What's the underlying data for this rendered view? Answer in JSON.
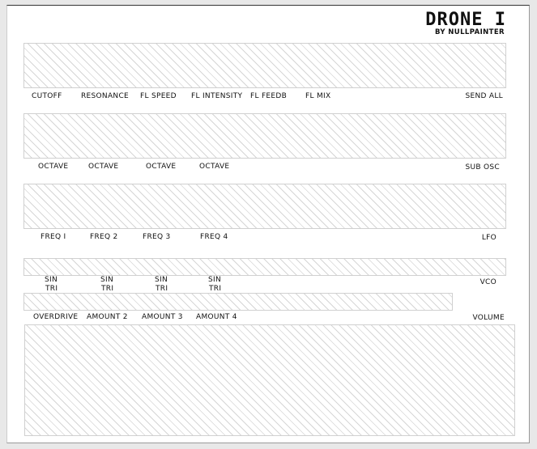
{
  "header": {
    "title": "DRONE I",
    "subtitle": "BY NULLPAINTER"
  },
  "row1": {
    "labels": [
      "CUTOFF",
      "RESONANCE",
      "FL SPEED",
      "FL INTENSITY",
      "FL FEEDB",
      "FL MIX"
    ],
    "side_label": "SEND ALL"
  },
  "row2": {
    "labels": [
      "OCTAVE",
      "OCTAVE",
      "OCTAVE",
      "OCTAVE"
    ],
    "side_label": "SUB OSC"
  },
  "row3": {
    "labels": [
      "FREQ I",
      "FREQ 2",
      "FREQ 3",
      "FREQ 4"
    ],
    "side_label": "LFO"
  },
  "row4": {
    "wave_top": [
      "SIN",
      "SIN",
      "SIN",
      "SIN"
    ],
    "wave_bottom": [
      "TRI",
      "TRI",
      "TRI",
      "TRI"
    ],
    "side_label": "VCO"
  },
  "row5": {
    "labels": [
      "OVERDRIVE",
      "AMOUNT  2",
      "AMOUNT  3",
      "AMOUNT 4"
    ],
    "side_label": "VOLUME"
  }
}
